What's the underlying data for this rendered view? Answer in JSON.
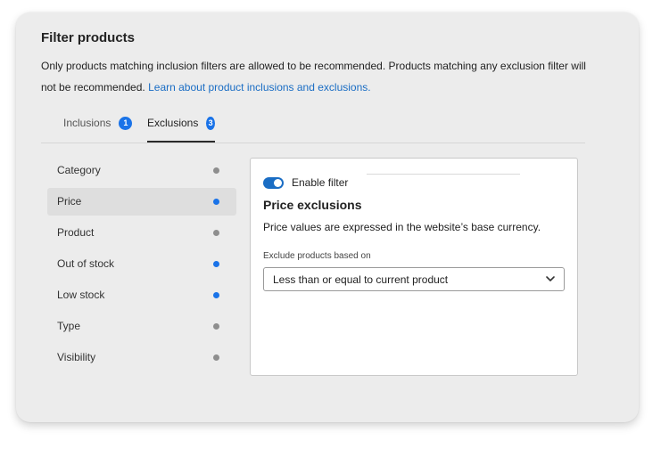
{
  "header": {
    "title": "Filter products",
    "description": "Only products matching inclusion filters are allowed to be recommended. Products matching any exclusion filter will not be recommended.",
    "learn_link": "Learn about product inclusions and exclusions."
  },
  "tabs": [
    {
      "label": "Inclusions",
      "count": "1",
      "active": false
    },
    {
      "label": "Exclusions",
      "count": "3",
      "active": true
    }
  ],
  "sidebar": {
    "items": [
      {
        "label": "Category",
        "active": false,
        "selected": false
      },
      {
        "label": "Price",
        "active": true,
        "selected": true
      },
      {
        "label": "Product",
        "active": false,
        "selected": false
      },
      {
        "label": "Out of stock",
        "active": true,
        "selected": false
      },
      {
        "label": "Low stock",
        "active": true,
        "selected": false
      },
      {
        "label": "Type",
        "active": false,
        "selected": false
      },
      {
        "label": "Visibility",
        "active": false,
        "selected": false
      }
    ]
  },
  "panel": {
    "toggle_label": "Enable filter",
    "toggle_on": true,
    "title": "Price exclusions",
    "description": "Price values are expressed in the website’s base currency.",
    "field_label": "Exclude products based on",
    "select_value": "Less than or equal to current product"
  },
  "colors": {
    "accent": "#1a73e8",
    "link": "#1a6dc4",
    "dot_active": "#1a73e8",
    "dot_inactive": "#8e8e8e"
  }
}
